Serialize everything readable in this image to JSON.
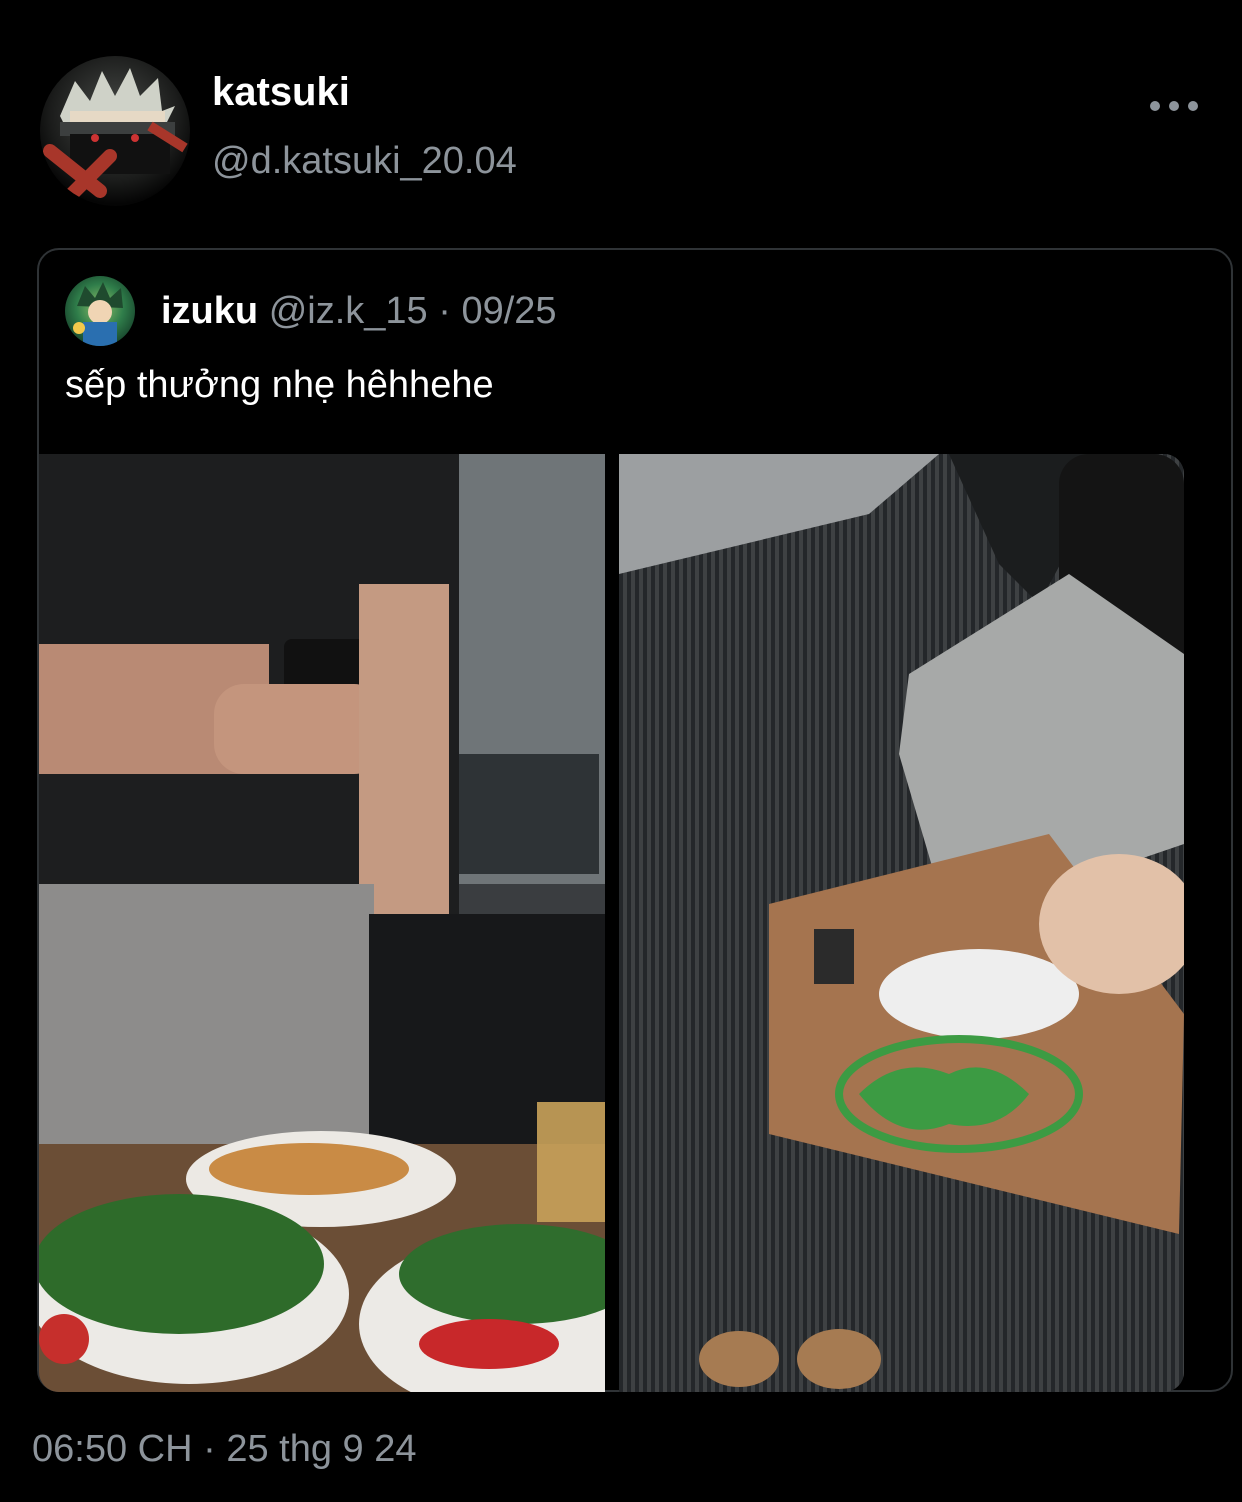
{
  "tweet": {
    "author_name": "katsuki",
    "author_handle": "@d.katsuki_20.04",
    "timestamp": "06:50 CH",
    "date": "25 thg 9 24",
    "separator": "·"
  },
  "quoted": {
    "name": "izuku",
    "handle": "@iz.k_15",
    "separator": "·",
    "date": "09/25",
    "text": "sếp thưởng nhẹ hêhhehe"
  },
  "icons": {
    "more": "more-horizontal-icon"
  },
  "colors": {
    "background": "#000000",
    "text_primary": "#ffffff",
    "text_secondary": "#8d949b",
    "border": "#2f3336"
  }
}
